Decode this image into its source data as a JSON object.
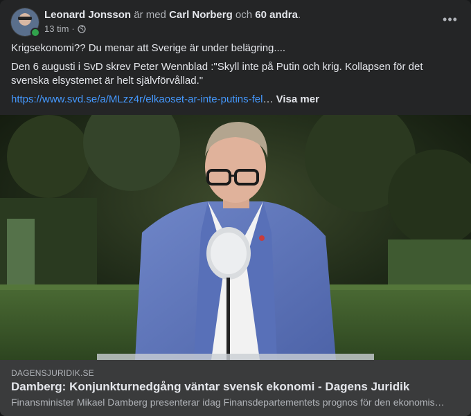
{
  "post": {
    "author": "Leonard Jonsson",
    "with_text": " är med ",
    "tagged_person": "Carl Norberg",
    "and_text": " och ",
    "others": "60 andra",
    "period": ".",
    "timestamp": "13 tim",
    "separator": " · ",
    "privacy_icon": "globe-icon",
    "more_icon": "•••",
    "text_line1": "Krigsekonomi?? Du menar att Sverige är under belägring....",
    "text_para2": "Den 6 augusti i SvD skrev Peter Wennblad :\"Skyll inte på Putin och krig. Kollapsen för det svenska elsystemet är helt självförvållad.\"",
    "url_text": "https://www.svd.se/a/MLzz4r/elkaoset-ar-inte-putins-fel",
    "ellipsis": "…",
    "see_more": "Visa mer"
  },
  "link_preview": {
    "domain": "DAGENSJURIDIK.SE",
    "title": "Damberg: Konjunkturnedgång väntar svensk ekonomi - Dagens Juridik",
    "description": "Finansminister Mikael Damberg presenterar idag Finansdepartementets prognos för den ekonomiska utvecklingen"
  },
  "colors": {
    "card_bg": "#242526",
    "link": "#4599ff",
    "online": "#31a24c",
    "preview_bg": "#3a3b3c"
  }
}
